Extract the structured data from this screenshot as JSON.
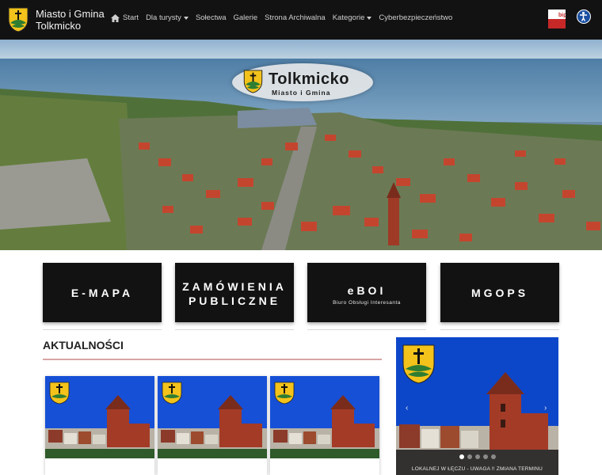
{
  "header": {
    "brand_line1": "Miasto i Gmina",
    "brand_line2": "Tolkmicko",
    "nav": [
      {
        "label": "Start",
        "icon": "home-icon"
      },
      {
        "label": "Dla turysty",
        "dropdown": true
      },
      {
        "label": "Sołectwa"
      },
      {
        "label": "Galerie"
      },
      {
        "label": "Strona Archiwalna"
      },
      {
        "label": "Kategorie",
        "dropdown": true
      },
      {
        "label": "Cyberbezpieczeństwo"
      }
    ],
    "bip_label": "bip"
  },
  "hero": {
    "title": "Tolkmicko",
    "subtitle": "Miasto i Gmina"
  },
  "tiles": [
    {
      "label": "E-MAPA"
    },
    {
      "label_line1": "ZAMÓWIENIA",
      "label_line2": "PUBLICZNE"
    },
    {
      "label": "eBOI",
      "sub": "Biuro Obsługi Interesanta"
    },
    {
      "label": "MGOPS"
    }
  ],
  "news": {
    "heading": "AKTUALNOŚCI"
  },
  "carousel": {
    "caption_line1": "LOKALNEJ W ŁĘCZU - UWAGA !! ZMIANA TERMINU",
    "prev": "‹",
    "next": "›"
  },
  "colors": {
    "navbar": "#121212",
    "shield_yellow": "#f3c21b",
    "sky_blue": "#0d47c9",
    "roof_red": "#c0392b"
  }
}
